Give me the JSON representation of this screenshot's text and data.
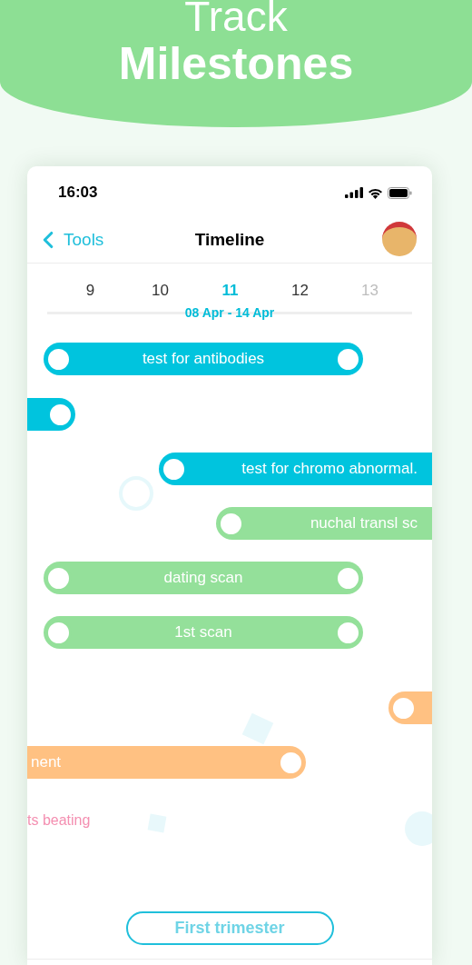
{
  "banner": {
    "title_lines": [
      "Track",
      "Milestones"
    ]
  },
  "status_bar": {
    "time": "16:03"
  },
  "nav": {
    "back": "Tools",
    "title": "Timeline"
  },
  "weeks": [
    {
      "label": "9",
      "selected": false,
      "dimmed": false
    },
    {
      "label": "10",
      "selected": false,
      "dimmed": false
    },
    {
      "label": "11",
      "selected": true,
      "dimmed": false
    },
    {
      "label": "12",
      "selected": false,
      "dimmed": false
    },
    {
      "label": "13",
      "selected": false,
      "dimmed": true
    }
  ],
  "range": "08 Apr - 14 Apr",
  "events": [
    {
      "kind": "both",
      "label": "test for antibodies",
      "color": "#00c4de"
    },
    {
      "kind": "end",
      "color": "#00c4de"
    },
    {
      "kind": "start",
      "label": "test for chromo abnormal.",
      "color": "#00c4de"
    },
    {
      "kind": "start",
      "label": "nuchal transl sc",
      "color": "#94e09a"
    },
    {
      "kind": "both",
      "label": "dating scan",
      "color": "#94e09a"
    },
    {
      "kind": "both",
      "label": "1st scan",
      "color": "#94e09a"
    },
    {
      "kind": "start",
      "color": "#ffc182"
    },
    {
      "kind": "end",
      "label": "nent",
      "color": "#ffc182"
    },
    {
      "kind": "note",
      "label": "ts beating",
      "color": "#f48fb1"
    }
  ],
  "trimester_button": "First trimester"
}
